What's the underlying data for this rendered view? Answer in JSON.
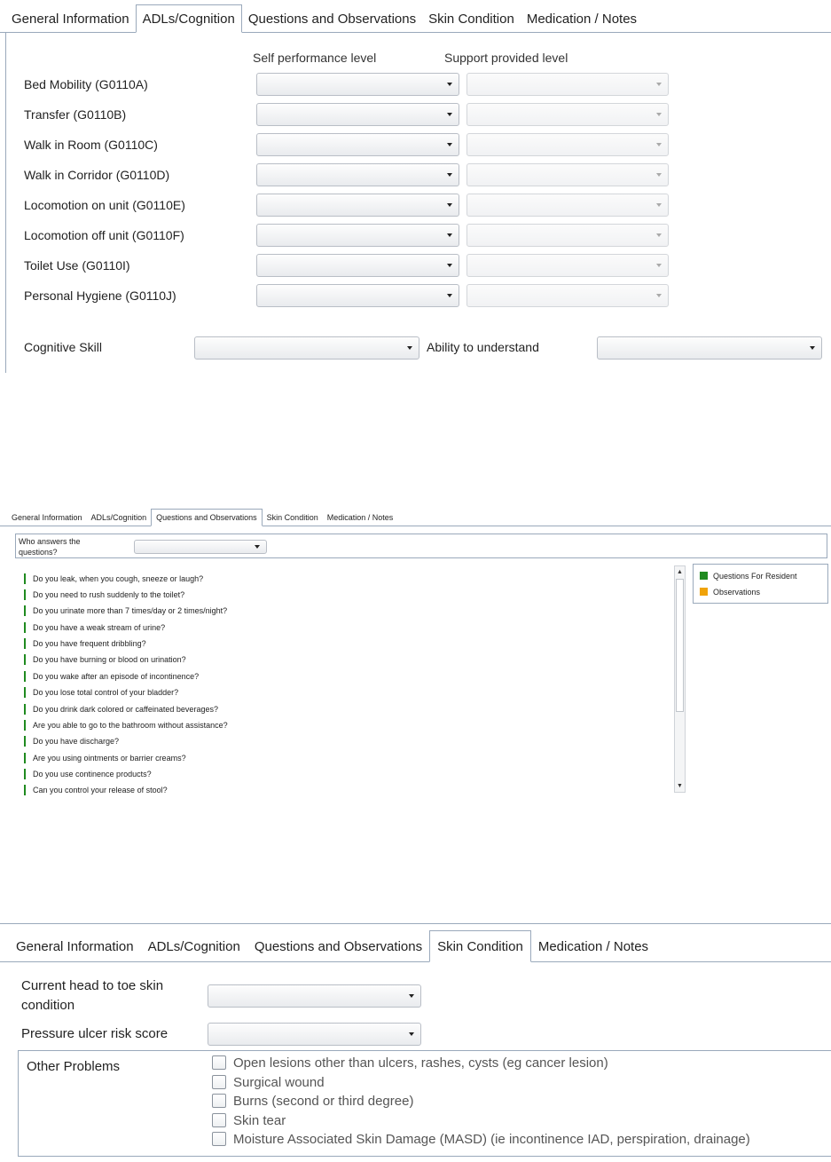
{
  "panel1": {
    "tabs": [
      "General Information",
      "ADLs/Cognition",
      "Questions and Observations",
      "Skin Condition",
      "Medication / Notes"
    ],
    "active_tab": "ADLs/Cognition",
    "column_headers": {
      "self_performance": "Self performance level",
      "support_provided": "Support provided level"
    },
    "adl_rows": [
      {
        "label": "Bed Mobility (G0110A)"
      },
      {
        "label": "Transfer (G0110B)"
      },
      {
        "label": "Walk in Room (G0110C)"
      },
      {
        "label": "Walk in Corridor (G0110D)"
      },
      {
        "label": "Locomotion on unit (G0110E)"
      },
      {
        "label": "Locomotion off unit (G0110F)"
      },
      {
        "label": "Toilet Use (G0110I)"
      },
      {
        "label": "Personal Hygiene (G0110J)"
      }
    ],
    "cognitive_skill_label": "Cognitive Skill",
    "ability_to_understand_label": "Ability to understand"
  },
  "panel2": {
    "tabs": [
      "General Information",
      "ADLs/Cognition",
      "Questions and Observations",
      "Skin Condition",
      "Medication / Notes"
    ],
    "active_tab": "Questions and Observations",
    "who_answers_label": "Who answers the questions?",
    "questions": [
      "Do you leak, when you cough, sneeze or laugh?",
      "Do you need to rush suddenly to the toilet?",
      "Do you urinate more than 7 times/day or 2 times/night?",
      "Do you have a weak stream of urine?",
      "Do you have frequent dribbling?",
      "Do you have burning or blood on urination?",
      "Do you wake after an episode of incontinence?",
      "Do you lose total control of your bladder?",
      "Do you drink dark colored or caffeinated beverages?",
      "Are you able to go to the bathroom without assistance?",
      "Do you have discharge?",
      "Are you using ointments or barrier creams?",
      "Do you use continence products?",
      "Can you control your release of stool?"
    ],
    "legend": [
      {
        "label": "Questions For Resident",
        "color": "#1f8a1f"
      },
      {
        "label": "Observations",
        "color": "#f0a30a"
      }
    ]
  },
  "panel3": {
    "tabs": [
      "General Information",
      "ADLs/Cognition",
      "Questions and Observations",
      "Skin Condition",
      "Medication / Notes"
    ],
    "active_tab": "Skin Condition",
    "head_to_toe_label": "Current head to toe skin condition",
    "pressure_ulcer_label": "Pressure ulcer risk score",
    "other_problems_label": "Other Problems",
    "other_problems": [
      {
        "label": "Open lesions other than ulcers, rashes, cysts (eg cancer lesion)",
        "checked": false
      },
      {
        "label": "Surgical wound",
        "checked": false
      },
      {
        "label": "Burns (second or third degree)",
        "checked": false
      },
      {
        "label": "Skin tear",
        "checked": false
      },
      {
        "label": "Moisture Associated Skin Damage (MASD) (ie incontinence IAD, perspiration, drainage)",
        "checked": false
      }
    ]
  }
}
